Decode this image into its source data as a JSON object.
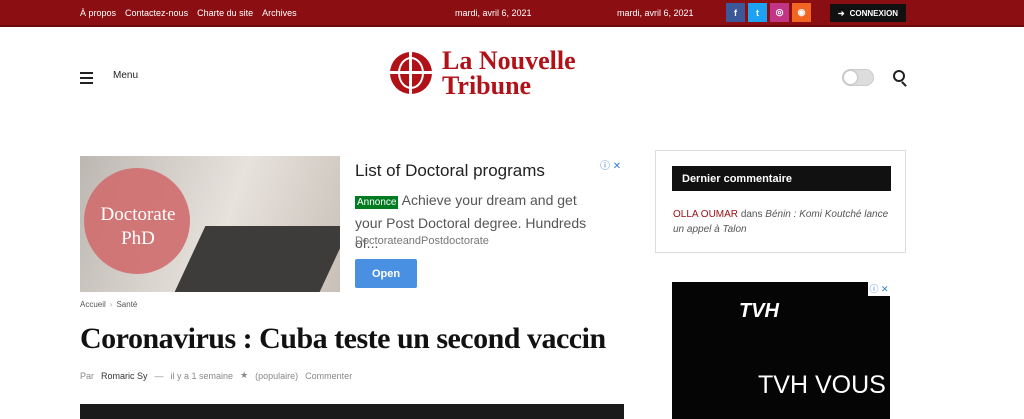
{
  "top": {
    "links": [
      "À propos",
      "Contactez-nous",
      "Charte du site",
      "Archives"
    ],
    "date_left": "mardi, avril 6, 2021",
    "date_right": "mardi, avril 6, 2021",
    "connect": "CONNEXION",
    "social": [
      {
        "name": "facebook-icon",
        "label": "f",
        "color": "#3b5998"
      },
      {
        "name": "twitter-icon",
        "label": "t",
        "color": "#1da1f2"
      },
      {
        "name": "instagram-icon",
        "label": "◎",
        "color": "#c13584"
      },
      {
        "name": "rss-icon",
        "label": "◉",
        "color": "#f26522"
      }
    ]
  },
  "header": {
    "menu": "Menu",
    "logo_line1": "La Nouvelle",
    "logo_line2": "Tribune"
  },
  "ad": {
    "image_line1": "Doctorate",
    "image_line2": "PhD",
    "title": "List of Doctoral programs",
    "badge": "Annonce",
    "body": "Achieve your dream and get your Post Doctoral degree. Hundreds of...",
    "url": "DoctorateandPostdoctorate",
    "button": "Open"
  },
  "breadcrumb": {
    "home": "Accueil",
    "section": "Santé"
  },
  "article": {
    "title": "Coronavirus : Cuba teste un second vaccin",
    "author_prefix": "Par",
    "author": "Romaric Sy",
    "dash": "—",
    "time": "il y a 1 semaine",
    "popular": "(populaire)",
    "comments": "Commenter"
  },
  "sidebar": {
    "heading": "Dernier commentaire",
    "comment_author": "OLLA OUMAR",
    "comment_in": "dans",
    "comment_post": "Bénin : Komi Koutché lance un appel à Talon"
  },
  "side_ad": {
    "logo": "TVH",
    "text": "TVH VOUS"
  }
}
